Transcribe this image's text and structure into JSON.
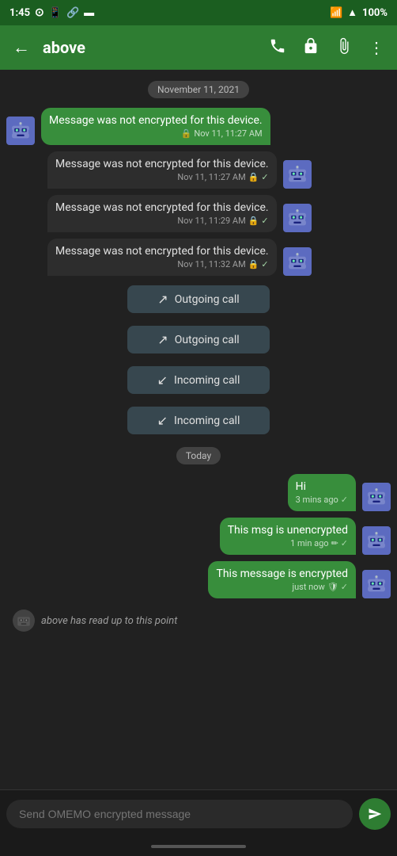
{
  "statusBar": {
    "time": "1:45",
    "batteryPercent": "100%"
  },
  "appBar": {
    "title": "above",
    "backLabel": "←",
    "phoneIcon": "📞",
    "lockIcon": "🔒",
    "attachIcon": "📎",
    "menuIcon": "⋮"
  },
  "dateDividers": {
    "november": "November 11, 2021",
    "today": "Today"
  },
  "messages": [
    {
      "type": "sent-with-avatar",
      "text": "Message was not encrypted for this device.",
      "time": "Nov 11, 11:27 AM",
      "hasLock": true,
      "hasCheck": false
    },
    {
      "type": "received",
      "text": "Message was not encrypted for this device.",
      "time": "Nov 11, 11:27 AM",
      "hasLock": true,
      "hasCheck": true
    },
    {
      "type": "received",
      "text": "Message was not encrypted for this device.",
      "time": "Nov 11, 11:29 AM",
      "hasLock": true,
      "hasCheck": true
    },
    {
      "type": "received",
      "text": "Message was not encrypted for this device.",
      "time": "Nov 11, 11:32 AM",
      "hasLock": true,
      "hasCheck": true
    }
  ],
  "calls": [
    {
      "type": "outgoing",
      "label": "Outgoing call",
      "arrow": "↗"
    },
    {
      "type": "outgoing",
      "label": "Outgoing call",
      "arrow": "↗"
    },
    {
      "type": "incoming",
      "label": "Incoming call",
      "arrow": "↙"
    },
    {
      "type": "incoming",
      "label": "Incoming call",
      "arrow": "↙"
    }
  ],
  "todayMessages": [
    {
      "type": "outgoing-right",
      "text": "Hi",
      "time": "3 mins ago",
      "hasCheck": true
    },
    {
      "type": "outgoing-right",
      "text": "This msg is unencrypted",
      "time": "1 min ago",
      "hasPencil": true,
      "hasCheck": true
    },
    {
      "type": "outgoing-right",
      "text": "This message is encrypted",
      "time": "just now",
      "hasShield": true,
      "hasCheck": true
    }
  ],
  "readReceipt": {
    "text": "above has read up to this point"
  },
  "input": {
    "placeholder": "Send OMEMO encrypted message",
    "sendIcon": "▶"
  }
}
